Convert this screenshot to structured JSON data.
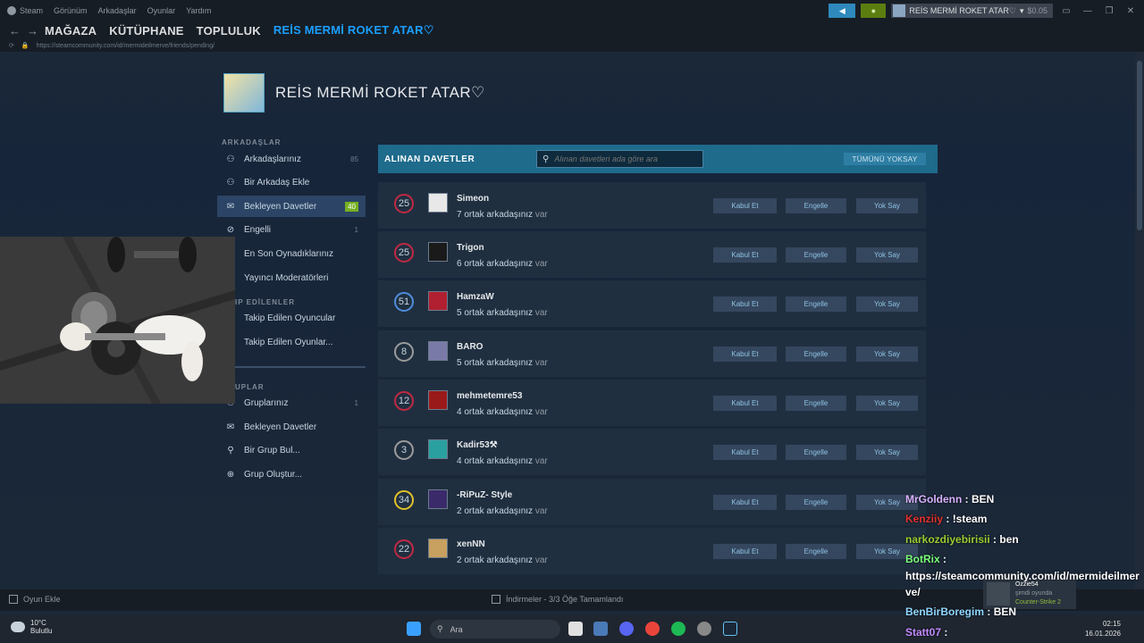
{
  "menu": {
    "items": [
      "Steam",
      "Görünüm",
      "Arkadaşlar",
      "Oyunlar",
      "Yardım"
    ]
  },
  "account": {
    "name": "REİS MERMİ ROKET ATAR♡",
    "balance": "$0.05"
  },
  "nav": {
    "tabs": [
      "MAĞAZA",
      "KÜTÜPHANE",
      "TOPLULUK",
      "REİS MERMİ ROKET ATAR♡"
    ],
    "url": "https://steamcommunity.com/id/mermideilmerve/friends/pending/"
  },
  "profile": {
    "name": "REİS MERMİ ROKET ATAR♡"
  },
  "sidebar": {
    "friends_header": "ARKADAŞLAR",
    "items": [
      {
        "label": "Arkadaşlarınız",
        "count": "85",
        "icon": "person-icon"
      },
      {
        "label": "Bir Arkadaş Ekle",
        "count": "",
        "icon": "add-person-icon"
      },
      {
        "label": "Bekleyen Davetler",
        "count": "40",
        "icon": "mail-icon"
      },
      {
        "label": "Engelli",
        "count": "1",
        "icon": "block-icon"
      },
      {
        "label": "En Son Oynadıklarınız",
        "count": "",
        "icon": ""
      },
      {
        "label": "Yayıncı Moderatörleri",
        "count": "",
        "icon": ""
      }
    ],
    "following_header": "IP EDİLENLER",
    "following_items": [
      {
        "label": "Takip Edilen Oyuncular"
      },
      {
        "label": "Takip Edilen Oyunlar..."
      }
    ],
    "groups_header": "UPLAR",
    "group_items": [
      {
        "label": "Gruplarınız",
        "count": "1",
        "icon": "group-icon"
      },
      {
        "label": "Bekleyen Davetler",
        "count": "",
        "icon": "mail-icon"
      },
      {
        "label": "Bir Grup Bul...",
        "count": "",
        "icon": "search-icon"
      },
      {
        "label": "Grup Oluştur...",
        "count": "",
        "icon": "plus-circle-icon"
      }
    ]
  },
  "invites": {
    "title": "ALINAN DAVETLER",
    "search_placeholder": "Alınan davetleri ada göre ara",
    "ignore_all": "TÜMÜNÜ YOKSAY",
    "accept_label": "Kabul Et",
    "block_label": "Engelle",
    "ignore_label": "Yok Say",
    "var_word": "var",
    "rows": [
      {
        "level": "25",
        "name": "Simeon",
        "mutual": "7 ortak arkadaşınız",
        "ring": "#c02942",
        "avatar": "#e8e8e8"
      },
      {
        "level": "25",
        "name": "Trigon",
        "mutual": "6 ortak arkadaşınız",
        "ring": "#c02942",
        "avatar": "#1a1a1a"
      },
      {
        "level": "51",
        "name": "HamzaW",
        "mutual": "5 ortak arkadaşınız",
        "ring": "#4e8ddb",
        "avatar": "#b02030"
      },
      {
        "level": "8",
        "name": "BARO",
        "mutual": "5 ortak arkadaşınız",
        "ring": "#9b9b9b",
        "avatar": "#7a7aa8"
      },
      {
        "level": "12",
        "name": "mehmetemre53",
        "mutual": "4 ortak arkadaşınız",
        "ring": "#c02942",
        "avatar": "#9a1a1a"
      },
      {
        "level": "3",
        "name": "Kadir53⚒",
        "mutual": "4 ortak arkadaşınız",
        "ring": "#9b9b9b",
        "avatar": "#2aa0a0"
      },
      {
        "level": "34",
        "name": "-RiPuZ- Style",
        "mutual": "2 ortak arkadaşınız",
        "ring": "#e0c22a",
        "avatar": "#3a2a6a"
      },
      {
        "level": "22",
        "name": "xenNN",
        "mutual": "2 ortak arkadaşınız",
        "ring": "#c02942",
        "avatar": "#c8a060"
      }
    ]
  },
  "bottombar": {
    "add_game": "Oyun Ekle",
    "downloads": "İndirmeler - 3/3 Öğe Tamamlandı"
  },
  "taskbar": {
    "temp": "10°C",
    "weather": "Bulutlu",
    "search": "Ara",
    "time": "02:15",
    "date": "16.01.2026",
    "badge": "4"
  },
  "friend_popup": {
    "name": "Ozzie54",
    "status": "şimdi oyunda",
    "game": "Counter-Strike 2"
  },
  "chat": [
    {
      "user": "MrGoldenn",
      "msg": ": BEN",
      "color": "#d9b3ff"
    },
    {
      "user": "Kenziiy",
      "msg": ": !steam",
      "color": "#e0322d"
    },
    {
      "user": "narkozdiyebirisii",
      "msg": ": ben",
      "color": "#9acd32"
    },
    {
      "user": "BotRix",
      "msg": ":",
      "color": "#7cff7c"
    },
    {
      "user": "",
      "msg": "https://steamcommunity.com/id/mermideilmer",
      "color": "#ffffff"
    },
    {
      "user": "",
      "msg": "ve/",
      "color": "#ffffff"
    },
    {
      "user": "BenBirBoregim",
      "msg": ": BEN",
      "color": "#8fd6ff"
    },
    {
      "user": "Statt07",
      "msg": ":",
      "color": "#c28bff"
    }
  ]
}
